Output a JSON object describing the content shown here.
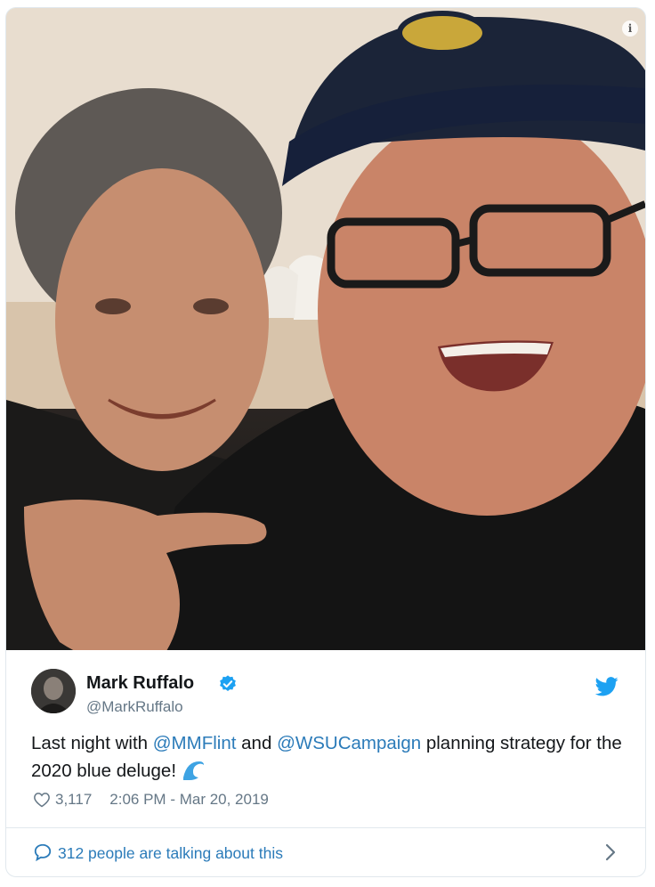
{
  "tweet": {
    "author_name": "Mark Ruffalo",
    "author_handle": "@MarkRuffalo",
    "text_before": "Last night with ",
    "mention_1": "@MMFlint",
    "text_middle": " and ",
    "mention_2": "@WSUCampaign",
    "text_after": " planning strategy for the 2020 blue deluge!",
    "emoji": "wave-emoji",
    "likes": "3,117",
    "timestamp": "2:06 PM - Mar 20, 2019",
    "talking": "312 people are talking about this"
  },
  "icons": {
    "info": "info-icon",
    "verified": "verified-badge-icon",
    "brand": "twitter-bird-icon",
    "like": "heart-icon",
    "reply": "speech-bubble-icon",
    "more": "chevron-right-icon"
  },
  "colors": {
    "link": "#2b7bb9",
    "secondary_text": "#657786",
    "border": "#e1e8ed",
    "twitter_blue": "#1da1f2"
  }
}
